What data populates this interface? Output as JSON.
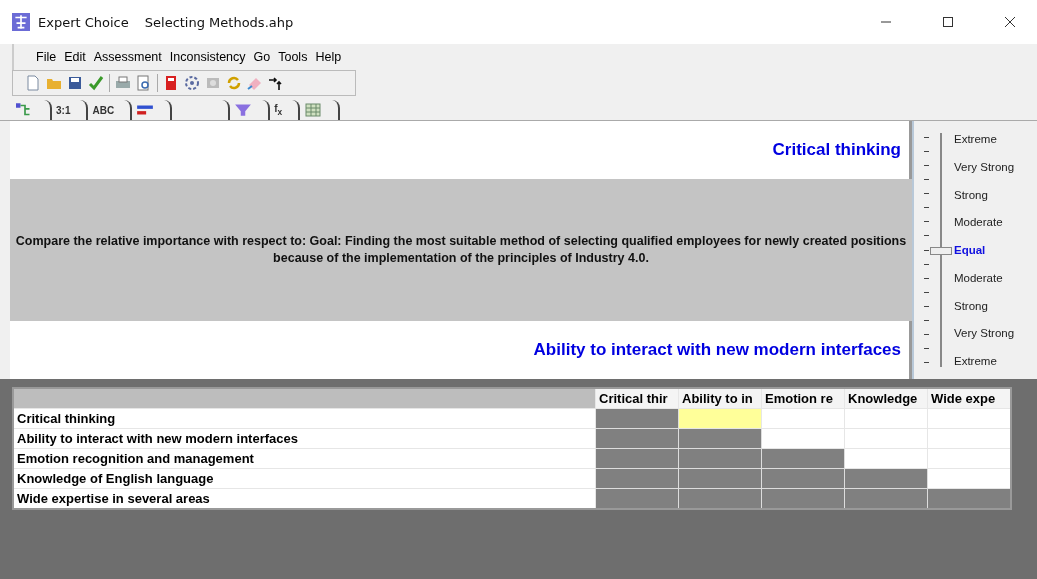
{
  "window": {
    "app": "Expert Choice",
    "title": "Selecting Methods.ahp"
  },
  "menu": [
    "File",
    "Edit",
    "Assessment",
    "Inconsistency",
    "Go",
    "Tools",
    "Help"
  ],
  "toolbar": [
    {
      "kind": "new"
    },
    {
      "kind": "open"
    },
    {
      "kind": "save"
    },
    {
      "kind": "check"
    },
    {
      "kind": "sep"
    },
    {
      "kind": "print"
    },
    {
      "kind": "preview"
    },
    {
      "kind": "sep"
    },
    {
      "kind": "calc"
    },
    {
      "kind": "gear"
    },
    {
      "kind": "disk"
    },
    {
      "kind": "refresh"
    },
    {
      "kind": "eraser"
    },
    {
      "kind": "arrows"
    }
  ],
  "tabs": [
    {
      "kind": "tree"
    },
    {
      "kind": "text",
      "label": "3:1"
    },
    {
      "kind": "text",
      "label": "ABC"
    },
    {
      "kind": "bars"
    },
    {
      "kind": "blank"
    },
    {
      "kind": "funnel"
    },
    {
      "kind": "text",
      "label": "f$_{x}$"
    },
    {
      "kind": "grid"
    }
  ],
  "comparison": {
    "top": "Critical thinking",
    "prompt": "Compare the relative importance with respect to: Goal: Finding the most suitable method of selecting qualified employees for newly created positions because of the implementation of the principles of Industry 4.0.",
    "bottom": "Ability to interact with new modern interfaces"
  },
  "scale": {
    "level": 0.5,
    "labels": [
      {
        "text": "Extreme",
        "selected": false
      },
      {
        "text": "Very Strong",
        "selected": false
      },
      {
        "text": "Strong",
        "selected": false
      },
      {
        "text": "Moderate",
        "selected": false
      },
      {
        "text": "Equal",
        "selected": true
      },
      {
        "text": "Moderate",
        "selected": false
      },
      {
        "text": "Strong",
        "selected": false
      },
      {
        "text": "Very Strong",
        "selected": false
      },
      {
        "text": "Extreme",
        "selected": false
      }
    ]
  },
  "matrix": {
    "columns": [
      "Critical thir",
      "Ability to in",
      "Emotion re",
      "Knowledge",
      "Wide expe"
    ],
    "rows": [
      {
        "label": "Critical thinking",
        "cells": [
          {
            "kind": "blocked",
            "selected": false
          },
          {
            "kind": "open",
            "selected": true
          },
          {
            "kind": "open",
            "selected": false
          },
          {
            "kind": "open",
            "selected": false
          },
          {
            "kind": "open",
            "selected": false
          }
        ]
      },
      {
        "label": "Ability to interact with new modern interfaces",
        "cells": [
          {
            "kind": "blocked",
            "selected": false
          },
          {
            "kind": "blocked",
            "selected": false
          },
          {
            "kind": "open",
            "selected": false
          },
          {
            "kind": "open",
            "selected": false
          },
          {
            "kind": "open",
            "selected": false
          }
        ]
      },
      {
        "label": "Emotion recognition and management",
        "cells": [
          {
            "kind": "blocked",
            "selected": false
          },
          {
            "kind": "blocked",
            "selected": false
          },
          {
            "kind": "blocked",
            "selected": false
          },
          {
            "kind": "open",
            "selected": false
          },
          {
            "kind": "open",
            "selected": false
          }
        ]
      },
      {
        "label": "Knowledge of English language",
        "cells": [
          {
            "kind": "blocked",
            "selected": false
          },
          {
            "kind": "blocked",
            "selected": false
          },
          {
            "kind": "blocked",
            "selected": false
          },
          {
            "kind": "blocked",
            "selected": false
          },
          {
            "kind": "open",
            "selected": false
          }
        ]
      },
      {
        "label": "Wide expertise in several areas",
        "cells": [
          {
            "kind": "blocked",
            "selected": false
          },
          {
            "kind": "blocked",
            "selected": false
          },
          {
            "kind": "blocked",
            "selected": false
          },
          {
            "kind": "blocked",
            "selected": false
          },
          {
            "kind": "blocked",
            "selected": false
          }
        ]
      }
    ]
  }
}
